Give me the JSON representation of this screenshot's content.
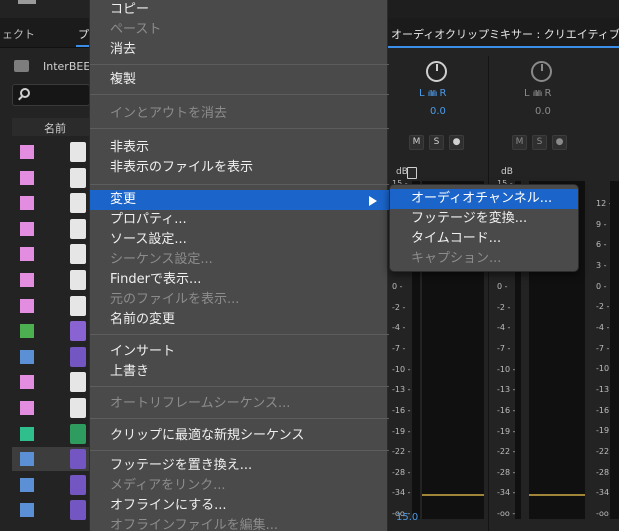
{
  "project_panel": {
    "tab_left": "ェクト",
    "tab_right": "プ",
    "folder_name": "InterBEE2",
    "column_name": "名前"
  },
  "assets": [
    {
      "color": "#e38de0",
      "icon": "graphic-icon",
      "kind": "white"
    },
    {
      "color": "#e38de0",
      "icon": "image-icon",
      "kind": "white"
    },
    {
      "color": "#e38de0",
      "icon": "image-icon",
      "kind": "white"
    },
    {
      "color": "#e38de0",
      "icon": "image-icon",
      "kind": "white"
    },
    {
      "color": "#e38de0",
      "icon": "image-icon",
      "kind": "white"
    },
    {
      "color": "#e38de0",
      "icon": "image-icon",
      "kind": "white"
    },
    {
      "color": "#e38de0",
      "icon": "graphic-icon",
      "kind": "white"
    },
    {
      "color": "#4caf50",
      "icon": "multicam-icon",
      "kind": "blue"
    },
    {
      "color": "#5b8fd6",
      "icon": "sequence-icon",
      "kind": "seq"
    },
    {
      "color": "#e38de0",
      "icon": "image-icon",
      "kind": "white"
    },
    {
      "color": "#e38de0",
      "icon": "image-icon",
      "kind": "white"
    },
    {
      "color": "#2fbf8c",
      "icon": "audio-icon",
      "kind": "green"
    },
    {
      "color": "#5b8fd6",
      "icon": "sequence-icon",
      "kind": "seq"
    },
    {
      "color": "#5b8fd6",
      "icon": "sequence-icon",
      "kind": "seq"
    },
    {
      "color": "#5b8fd6",
      "icon": "sequence-icon",
      "kind": "seq"
    }
  ],
  "mixer": {
    "title": "オーディオクリップミキサー : クリエイティブ",
    "channel1": {
      "l": "L",
      "r": "R",
      "pan": "0.0",
      "m": "M",
      "s": "S",
      "db": "dB",
      "top_val": "15",
      "bottom_val": "15.0"
    },
    "channel2": {
      "l": "L",
      "r": "R",
      "pan": "0.0",
      "m": "M",
      "s": "S",
      "db": "dB",
      "top_val": "15"
    },
    "scale": [
      "15",
      "12",
      "9",
      "6",
      "3",
      "0",
      "-2",
      "-4",
      "-7",
      "-10",
      "-13",
      "-16",
      "-19",
      "-22",
      "-28",
      "-34",
      "-oo"
    ],
    "right_scale": [
      "12",
      "9",
      "6",
      "3",
      "0",
      "-2",
      "-4",
      "-7",
      "-10",
      "-13",
      "-16",
      "-19",
      "-22",
      "-28",
      "-34",
      "-oo"
    ]
  },
  "menu": {
    "items": [
      {
        "label": "コピー",
        "disabled": false
      },
      {
        "label": "ペースト",
        "disabled": true
      },
      {
        "label": "消去",
        "disabled": false
      },
      {
        "label": "複製",
        "disabled": false
      },
      {
        "label": "インとアウトを消去",
        "disabled": true
      },
      {
        "label": "非表示",
        "disabled": false
      },
      {
        "label": "非表示のファイルを表示",
        "disabled": false
      },
      {
        "label": "変更",
        "disabled": false
      },
      {
        "label": "プロパティ...",
        "disabled": false
      },
      {
        "label": "ソース設定...",
        "disabled": false
      },
      {
        "label": "シーケンス設定...",
        "disabled": true
      },
      {
        "label": "Finderで表示...",
        "disabled": false
      },
      {
        "label": "元のファイルを表示...",
        "disabled": true
      },
      {
        "label": "名前の変更",
        "disabled": false
      },
      {
        "label": "インサート",
        "disabled": false
      },
      {
        "label": "上書き",
        "disabled": false
      },
      {
        "label": "オートリフレームシーケンス...",
        "disabled": true
      },
      {
        "label": "クリップに最適な新規シーケンス",
        "disabled": false
      },
      {
        "label": "フッテージを置き換え...",
        "disabled": false
      },
      {
        "label": "メディアをリンク...",
        "disabled": true
      },
      {
        "label": "オフラインにする...",
        "disabled": false
      },
      {
        "label": "オフラインファイルを編集...",
        "disabled": true
      }
    ]
  },
  "submenu": {
    "items": [
      {
        "label": "オーディオチャンネル...",
        "disabled": false
      },
      {
        "label": "フッテージを変換...",
        "disabled": false
      },
      {
        "label": "タイムコード...",
        "disabled": false
      },
      {
        "label": "キャプション...",
        "disabled": true
      }
    ]
  },
  "colors": {
    "accent": "#1b64c9",
    "meter_blue": "#4d9be8",
    "meter_floor": "#a08438"
  }
}
